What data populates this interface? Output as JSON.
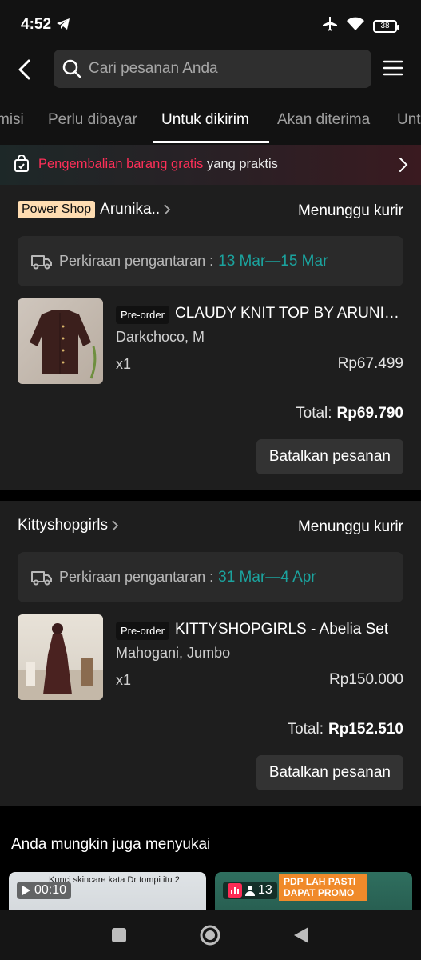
{
  "status_bar": {
    "time": "4:52",
    "battery": "38"
  },
  "header": {
    "search_placeholder": "Cari pesanan Anda"
  },
  "tabs": [
    {
      "label": "misi"
    },
    {
      "label": "Perlu dibayar"
    },
    {
      "label": "Untuk dikirim"
    },
    {
      "label": "Akan diterima"
    },
    {
      "label": "Unt"
    }
  ],
  "promo": {
    "highlight": "Pengembalian barang gratis",
    "rest": " yang praktis"
  },
  "orders": [
    {
      "badge": "Power Shop",
      "shop": "Arunika..",
      "status": "Menunggu kurir",
      "delivery_label": "Perkiraan pengantaran :",
      "delivery_date": "13 Mar—15 Mar",
      "preorder": "Pre-order",
      "product": "CLAUDY KNIT TOP BY ARUNIKA",
      "variant": "Darkchoco, M",
      "qty": "x1",
      "price": "Rp67.499",
      "total_label": "Total:",
      "total_value": "Rp69.790",
      "cancel": "Batalkan pesanan"
    },
    {
      "badge": "",
      "shop": "Kittyshopgirls",
      "status": "Menunggu kurir",
      "delivery_label": "Perkiraan pengantaran :",
      "delivery_date": "31 Mar—4 Apr",
      "preorder": "Pre-order",
      "product": "KITTYSHOPGIRLS - Abelia Set",
      "variant": "Mahogani, Jumbo",
      "qty": "x1",
      "price": "Rp150.000",
      "total_label": "Total:",
      "total_value": "Rp152.510",
      "cancel": "Batalkan pesanan"
    }
  ],
  "recommend": {
    "title": "Anda mungkin juga menyukai",
    "cards": [
      {
        "badge": "00:10",
        "caption": "Kunci skincare kata Dr tompi itu 2"
      },
      {
        "badge": "13",
        "caption": "PDP LAH PASTI DAPAT PROMO"
      }
    ]
  },
  "colors": {
    "accent_teal": "#1ba39e",
    "promo_red": "#fd2f58",
    "badge_bg": "#fedcb1"
  }
}
